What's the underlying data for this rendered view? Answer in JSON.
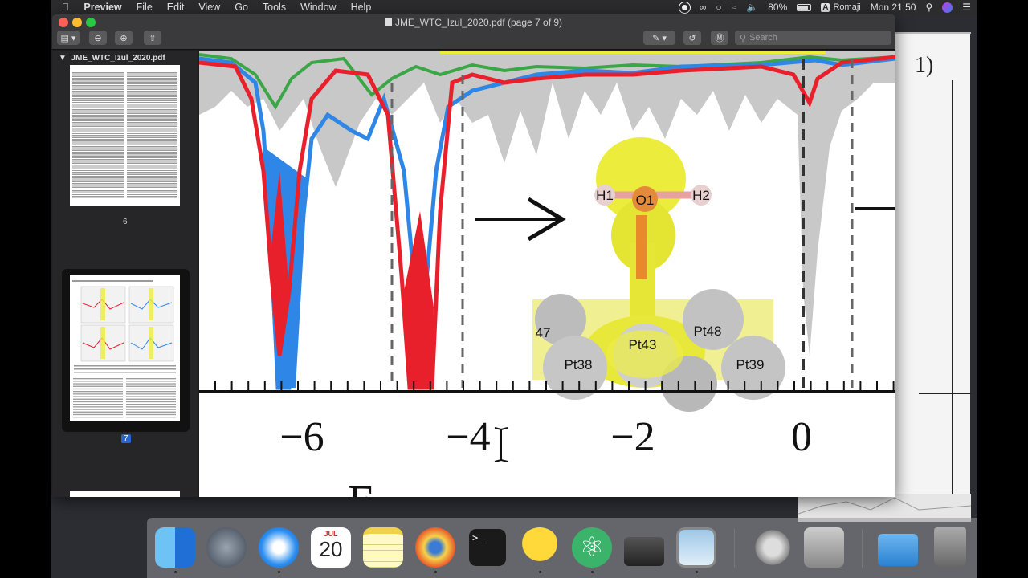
{
  "menubar": {
    "app": "Preview",
    "items": [
      "File",
      "Edit",
      "View",
      "Go",
      "Tools",
      "Window",
      "Help"
    ],
    "battery": "80%",
    "user": "Romaji",
    "clock": "Mon 21:50"
  },
  "window": {
    "title": "JME_WTC_Izul_2020.pdf (page 7 of 9)",
    "search_placeholder": "Search"
  },
  "sidebar": {
    "file_name": "JME_WTC_Izul_2020.pdf",
    "pages": [
      {
        "num": "6",
        "selected": false
      },
      {
        "num": "7",
        "selected": true
      }
    ]
  },
  "figure": {
    "x_ticks": [
      "−6",
      "−4",
      "−2",
      "0"
    ],
    "atom_labels": [
      "H1",
      "O1",
      "H2",
      "Pt43",
      "Pt48",
      "Pt38",
      "Pt39",
      "47"
    ],
    "colors": {
      "red": "#e8202c",
      "blue": "#2e86e6",
      "green": "#3aa646",
      "gray": "#c8c8c8",
      "yellow": "#ecec3c"
    }
  },
  "dock": {
    "calendar_month": "JUL",
    "calendar_day": "20",
    "items": [
      "finder-icon",
      "launchpad-icon",
      "safari-icon",
      "calendar-icon",
      "notes-icon",
      "molecule-app-icon",
      "terminal-icon",
      "cyberduck-icon",
      "atom-icon",
      "printer-icon",
      "preview-icon",
      "utility-icon",
      "disk-utility-icon",
      "downloads-icon",
      "trash-icon"
    ]
  }
}
